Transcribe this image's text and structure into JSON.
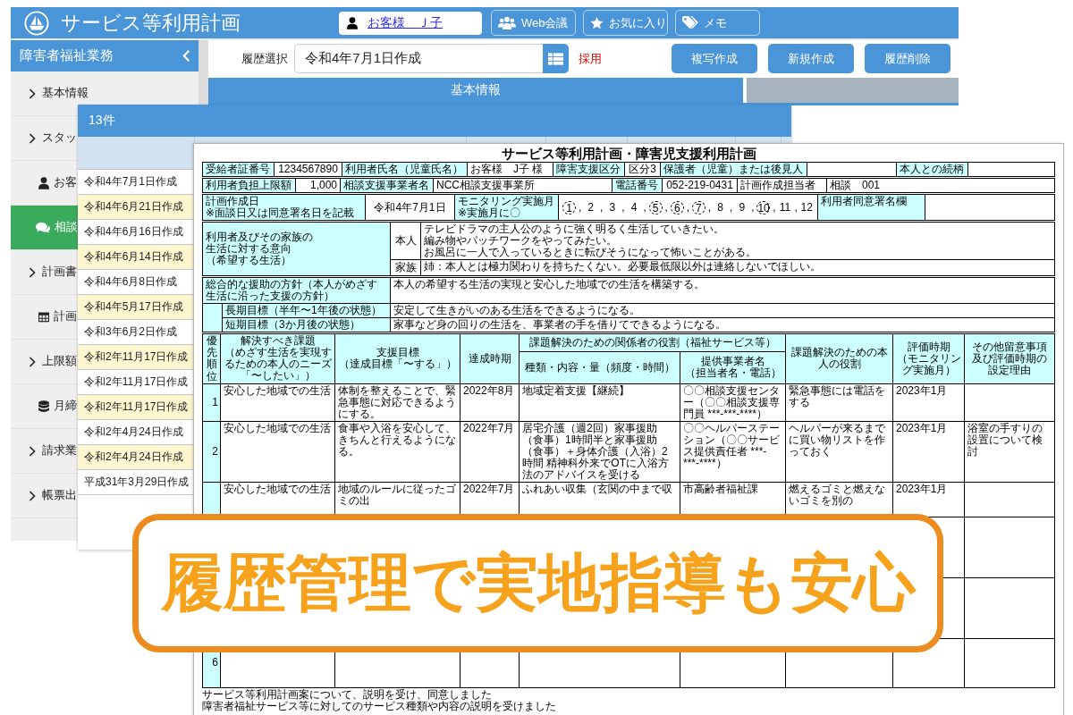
{
  "app": {
    "title": "サービス等利用計画",
    "customer": "お客様　Ｊ子",
    "header_buttons": [
      {
        "label": "Web会議",
        "kind": "people"
      },
      {
        "label": "お気に入り",
        "kind": "star"
      },
      {
        "label": "メモ",
        "kind": "tag"
      }
    ],
    "sidebar": {
      "title": "障害者福祉業務",
      "items": [
        {
          "label": "基本情報",
          "kind": "chevron",
          "selected": false
        },
        {
          "label": "スタッ",
          "kind": "chevron",
          "selected": false
        },
        {
          "label": "お客",
          "kind": "person",
          "selected": false
        },
        {
          "label": "相談",
          "kind": "chat",
          "selected": true
        },
        {
          "label": "計画書",
          "kind": "chevron",
          "selected": false
        },
        {
          "label": "計画",
          "kind": "table",
          "selected": false
        },
        {
          "label": "上限額",
          "kind": "chevron",
          "selected": false
        },
        {
          "label": "月締",
          "kind": "database",
          "selected": false
        },
        {
          "label": "請求業",
          "kind": "chevron",
          "selected": false
        },
        {
          "label": "帳票出",
          "kind": "chevron",
          "selected": false
        }
      ]
    },
    "history": {
      "label": "履歴選択",
      "value": "令和4年7月1日作成",
      "status": "採用"
    },
    "actions": [
      "複写作成",
      "新規作成",
      "履歴削除"
    ],
    "tabs": [
      {
        "label": "基本情報",
        "selected": true
      },
      {
        "selected": false
      }
    ]
  },
  "history_list": {
    "count": "13件",
    "items": [
      "令和4年7月1日作成",
      "令和4年6月21日作成",
      "令和4年6月16日作成",
      "令和4年6月14日作成",
      "令和4年6月8日作成",
      "令和4年5月17日作成",
      "令和3年6月2日作成",
      "令和2年11月17日作成",
      "令和2年11月17日作成",
      "令和2年11月17日作成",
      "令和2年4月24日作成",
      "令和2年4月24日作成",
      "平成31年3月29日作成"
    ]
  },
  "plan_document": {
    "title": "サービス等利用計画・障害児支援利用計画",
    "info_rows": [
      [
        {
          "kind": "label",
          "text": "受給者証番号"
        },
        {
          "kind": "figure",
          "text": "1234567890"
        },
        {
          "kind": "label",
          "text": "利用者氏名（児童氏名）"
        },
        {
          "kind": "text",
          "text": "お客様　J子 様"
        },
        {
          "kind": "label",
          "text": "障害支援区分"
        },
        {
          "kind": "figure",
          "text": "区分3"
        },
        {
          "kind": "label",
          "text": "保護者（児童）または後見人"
        },
        {
          "kind": "text"
        },
        {
          "kind": "label",
          "text": "本人との続柄"
        },
        {
          "kind": "text"
        }
      ],
      [
        {
          "kind": "label",
          "text": "利用者負担上限額"
        },
        {
          "kind": "amount",
          "text": "1,000"
        },
        {
          "kind": "label",
          "text": "相談支援事業者名"
        },
        {
          "kind": "text",
          "text": "NCC相談支援事業所"
        },
        {
          "kind": "label",
          "text": "電話番号"
        },
        {
          "kind": "figure",
          "text": "052-219-0431"
        },
        {
          "kind": "label_plain",
          "text": "計画作成担当者"
        },
        {
          "kind": "text",
          "text": "相談　001"
        }
      ],
      [
        {
          "kind": "label",
          "text": "計画作成日",
          "note": "※面談日又は同意署名日を記載"
        },
        {
          "kind": "figure",
          "text": "令和4年7月1日"
        },
        {
          "kind": "label",
          "text": "モニタリング実施月",
          "note": "※実施月に〇"
        },
        {
          "kind": "months",
          "separator": ",",
          "months": [
            {
              "text": "1",
              "circled": true
            },
            {
              "text": "2",
              "circled": false
            },
            {
              "text": "3",
              "circled": false
            },
            {
              "text": "4",
              "circled": false
            },
            {
              "text": "5",
              "circled": true
            },
            {
              "text": "6",
              "circled": true
            },
            {
              "text": "7",
              "circled": true
            },
            {
              "text": "8",
              "circled": false
            },
            {
              "text": "9",
              "circled": false
            },
            {
              "text": "10",
              "circled": true
            },
            {
              "text": "11",
              "circled": false
            },
            {
              "text": "12",
              "circled": false
            }
          ]
        },
        {
          "kind": "label",
          "text": "利用者同意署名欄"
        },
        {
          "kind": "text"
        }
      ]
    ],
    "intentions": {
      "label_lines": [
        "利用者及びその家族の",
        "生活に対する意向",
        "（希望する生活）"
      ],
      "entries": [
        {
          "who": "本人",
          "lines": [
            "テレビドラマの主人公のように強く明るく生活していきたい。",
            "編み物やパッチワークをやってみたい。",
            "お風呂に一人で入っているときに転びそうになって怖いことがある。"
          ]
        },
        {
          "who": "家族",
          "lines": [
            "姉：本人とは極力関わりを持ちたくない。必要最低限以外は連絡しないでほしい。"
          ]
        }
      ]
    },
    "policy": {
      "label": "総合的な援助の方針（本人がめざす生活に沿った支援の方針）",
      "text": "本人の希望する生活の実現と安心した地域での生活を構築する。"
    },
    "goals": [
      {
        "label": "長期目標",
        "note": "（半年〜1年後の状態）",
        "text": "安定して生きがいのある生活をできるようになる。"
      },
      {
        "label": "短期目標",
        "note": "（3か月後の状態）",
        "text": "家事など身の回りの生活を、事業者の手を借りてできるようになる。"
      }
    ],
    "plan_table": {
      "columns": [
        {
          "label": "優先順位",
          "kind": "vertical"
        },
        {
          "label": "解決すべき課題",
          "note": "（めざす生活を実現するための本人のニーズ「〜したい」）",
          "kind": "plain"
        },
        {
          "label": "支援目標",
          "note": "（達成目標「〜する」）",
          "kind": "plain"
        },
        {
          "label": "達成時期",
          "kind": "plain"
        },
        {
          "label": "課題解決のための関係者の役割（福祉サービス等）",
          "kind": "group",
          "children": [
            {
              "label": "種類・内容・量（頻度・時間）"
            },
            {
              "label": "提供事業者名",
              "note": "（担当者名・電話）"
            }
          ]
        },
        {
          "label": "課題解決のための本人の役割",
          "kind": "plain"
        },
        {
          "label": "評価時期",
          "note": "（モニタリング実施月）",
          "kind": "plain"
        },
        {
          "label": "その他留意事項及び評価時期の設定理由",
          "kind": "plain"
        }
      ],
      "rows": [
        {
          "priority": "1",
          "kind": "entry",
          "cells": [
            "安心した地域での生活",
            "体制を整えることで、緊急事態に対応できるようにする。",
            "2022年8月",
            "地域定着支援【継続】",
            "〇〇相談支援センター（〇〇相談支援専門員 ***-***-****）",
            "緊急事態には電話をする",
            "2023年1月"
          ]
        },
        {
          "priority": "2",
          "kind": "entry",
          "cells": [
            "安心した地域での生活",
            "食事や入浴を安心して、きちんと行えるようになる。",
            "2022年7月",
            "居宅介護（週2回）家事援助（食事）1時間半と家事援助（食事）＋身体介護（入浴）2時間 精神科外来でOTに入浴方法のアドバイスを受ける",
            "〇〇ヘルパーステーション（〇〇サービス提供責任者 ***-***-****）",
            "ヘルパーが来るまでに買い物リストを作っておく",
            "2023年1月",
            "浴室の手すりの設置について検討"
          ]
        },
        {
          "kind": "entry",
          "cells": [
            "安心した地域での生活",
            "地域のルールに従ったゴミの出",
            "2022年7月",
            "ふれあい収集（玄関の中まで収",
            "市高齢者福祉課",
            "燃えるゴミと燃えないゴミを別の",
            "2023年1月"
          ]
        },
        {
          "kind": "blank"
        },
        {
          "kind": "blank"
        },
        {
          "priority": "6",
          "kind": "blank"
        }
      ]
    },
    "notes": [
      "サービス等利用計画案について、説明を受け、同意しました",
      "障害者福祉サービス等に対してのサービス種類や内容の説明を受けました"
    ]
  },
  "banner": {
    "text": "履歴管理で実地指導も安心"
  }
}
